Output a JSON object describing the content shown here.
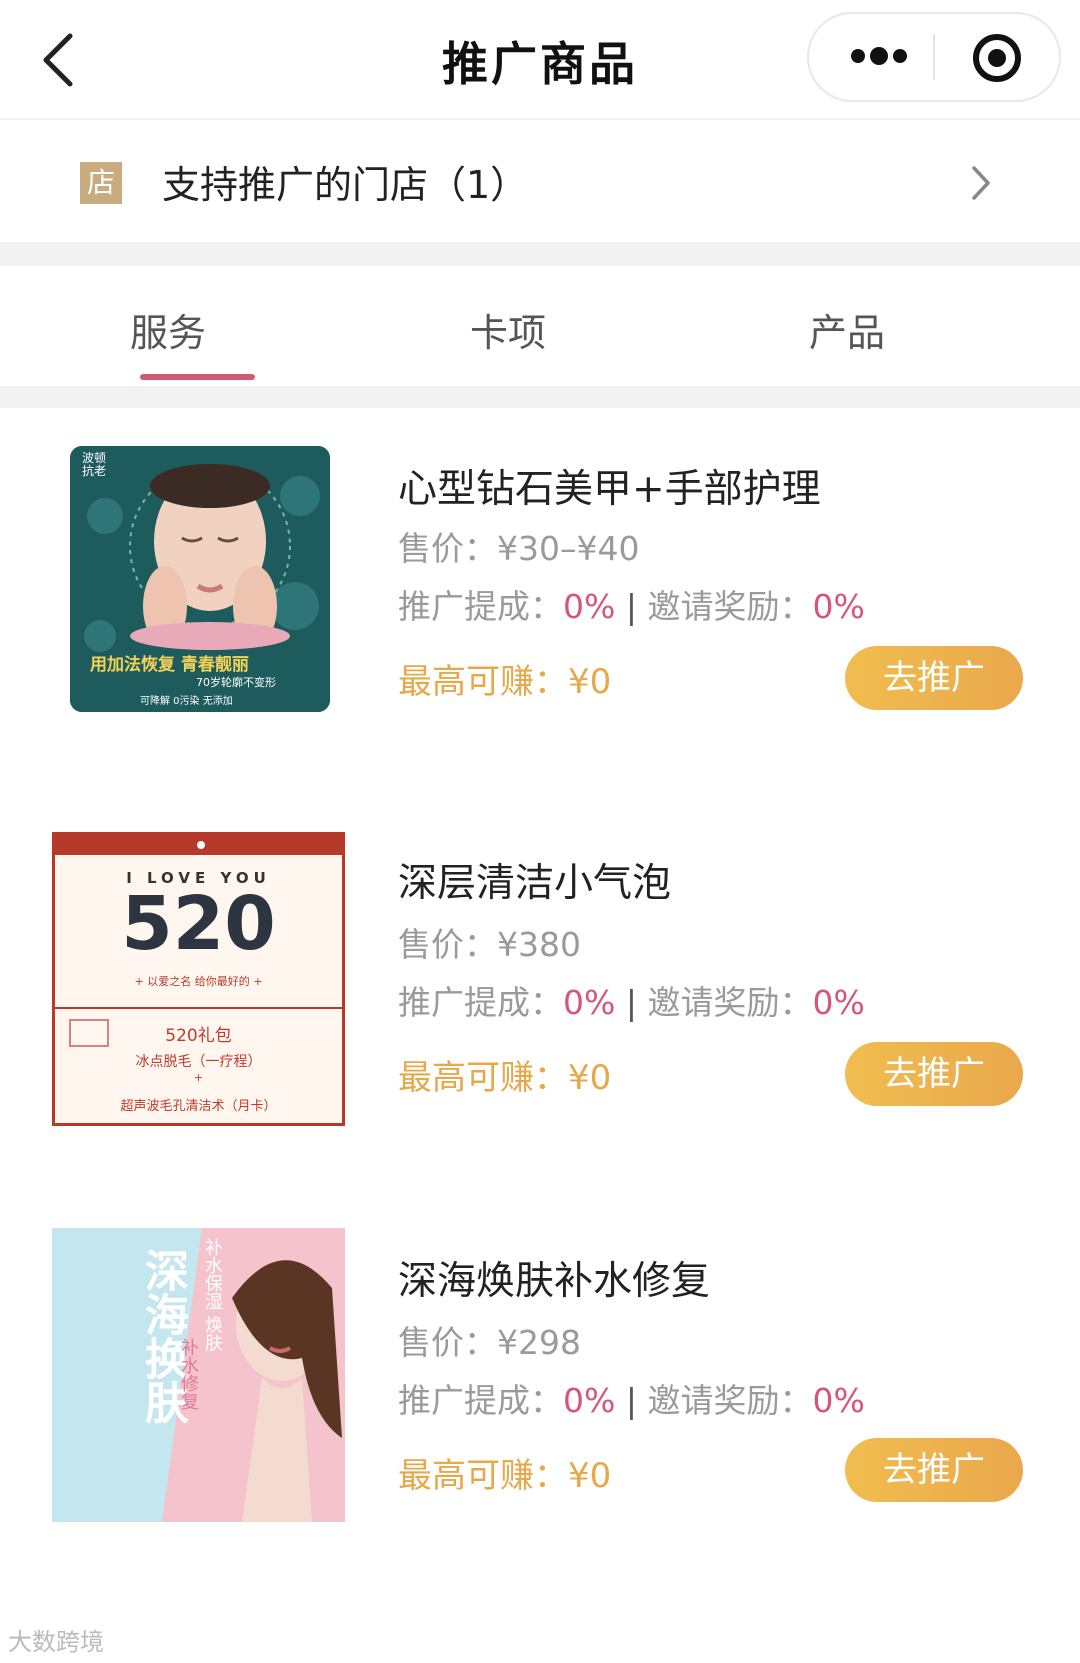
{
  "header": {
    "title": "推广商品",
    "back_icon": "chevron-left-icon",
    "more_icon": "more-dots-icon",
    "close_icon": "target-circle-icon"
  },
  "store": {
    "badge": "店",
    "label": "支持推广的门店（1）",
    "badge_color": "#c8ac7e"
  },
  "tabs": [
    {
      "label": "服务",
      "active": true
    },
    {
      "label": "卡项",
      "active": false
    },
    {
      "label": "产品",
      "active": false
    }
  ],
  "colors": {
    "accent_pink": "#cf5b77",
    "percent_pink": "#d4567a",
    "earn_orange": "#e7a84a",
    "button_orange": "#eeb04d"
  },
  "products": [
    {
      "name": "心型钻石美甲+手部护理",
      "price_label": "售价：",
      "price": "¥30–¥40",
      "commission_label": "推广提成：",
      "commission": "0%",
      "separator": "|",
      "invite_label": "邀请奖励：",
      "invite": "0%",
      "earn_label": "最高可赚：",
      "earn": "¥0",
      "button": "去推广",
      "image": {
        "line1": "用加法恢复 青春靓丽",
        "line2": "70岁轮廓不变形",
        "line3": "可降解 0污染 无添加",
        "corner": "波顿 抗老"
      }
    },
    {
      "name": "深层清洁小气泡",
      "price_label": "售价：",
      "price": "¥380",
      "commission_label": "推广提成：",
      "commission": "0%",
      "separator": "|",
      "invite_label": "邀请奖励：",
      "invite": "0%",
      "earn_label": "最高可赚：",
      "earn": "¥0",
      "button": "去推广",
      "image": {
        "top": "I LOVE YOU",
        "big": "520",
        "sub": "+ 以爱之名 给你最好的 +",
        "gift": "520礼包",
        "item1": "冰点脱毛（一疗程）",
        "plus": "+",
        "item2": "超声波毛孔清洁术（月卡）"
      }
    },
    {
      "name": "深海焕肤补水修复",
      "price_label": "售价：",
      "price": "¥298",
      "commission_label": "推广提成：",
      "commission": "0%",
      "separator": "|",
      "invite_label": "邀请奖励：",
      "invite": "0%",
      "earn_label": "最高可赚：",
      "earn": "¥0",
      "button": "去推广",
      "image": {
        "title": "深海换肤",
        "v1": "补水保湿 焕肤",
        "v2": "补水修复"
      }
    }
  ],
  "watermark": "大数跨境"
}
